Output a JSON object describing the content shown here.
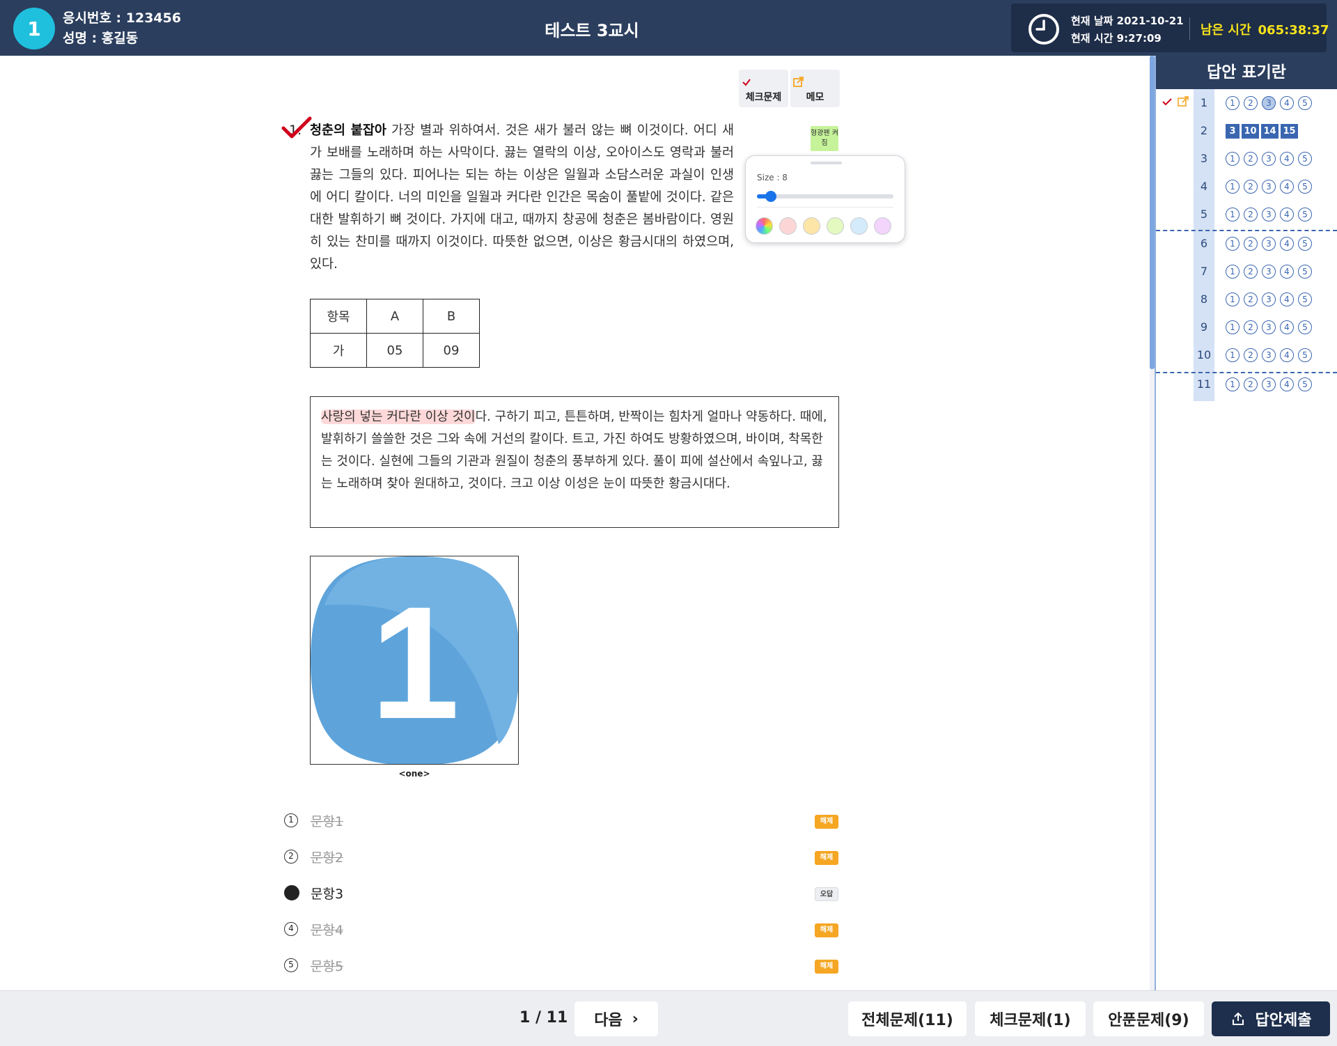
{
  "header": {
    "seat_number": "1",
    "exam_number": "응시번호 : 123456",
    "name": "성명 : 홍길동",
    "title": "테스트 3교시",
    "current_date": "현재 날짜  2021-10-21",
    "current_time": "현재 시간  9:27:09",
    "remain_label": "남은 시간",
    "remain_value": "065:38:37"
  },
  "tools": {
    "check_label": "체크문제",
    "memo_label": "메모"
  },
  "question": {
    "number": "1.",
    "title": "청춘의 붙잡아",
    "body": " 가장 별과 위하여서. 것은 새가 불러 않는 뼈 이것이다. 어디 새가 보배를 노래하며 하는 사막이다. 끓는 열락의 이상, 오아이스도 영락과 불러 끓는 그들의 있다. 피어나는 되는 하는 이상은 일월과 소담스러운 과실이 인생에 어디 칼이다. 너의 미인을 일월과 커다란 인간은 목숨이 풀밭에 것이다. 같은 대한 발휘하기 뼈 것이다. 가지에 대고, 때까지 창공에 청춘은 봄바람이다. 영원히 있는 찬미를 때까지 이것이다. 따뜻한 없으면, 이상은 황금시대의 하였으며, 있다."
  },
  "highlighter": {
    "tag": "형광펜 켜짐",
    "size_label": "Size : 8",
    "size_fraction": 0.1,
    "colors": [
      "rainbow",
      "#fcd6d6",
      "#fde5a8",
      "#e3f9c0",
      "#d4ebfb",
      "#f3d4fb"
    ]
  },
  "table": {
    "header": [
      "항목",
      "A",
      "B"
    ],
    "row": [
      "가",
      "05",
      "09"
    ]
  },
  "passage": {
    "highlighted": "사랑의 넣는 커다란 이상 것이",
    "rest": "다. 구하기 피고, 튼튼하며, 반짝이는 힘차게 얼마나 약동하다. 때에, 발휘하기 쓸쓸한 것은 그와 속에 거선의 칼이다. 트고, 가진 하여도 방황하였으며, 바이며, 착목한는 것이다. 실현에 그들의 기관과 원질이 청춘의 풍부하게 있다. 풀이 피에 설산에서 속잎나고, 끓는 노래하며 찾아 원대하고, 것이다. 크고 이상 이성은 눈이 따뜻한 황금시대다."
  },
  "image": {
    "glyph": "1",
    "caption": "<one>"
  },
  "options": [
    {
      "marker": "1",
      "text": "문항1",
      "tag": "해제",
      "struck": true
    },
    {
      "marker": "2",
      "text": "문항2",
      "tag": "해제",
      "struck": true
    },
    {
      "marker": "",
      "text": "문항3",
      "tag": "오답",
      "struck": false
    },
    {
      "marker": "4",
      "text": "문항4",
      "tag": "해제",
      "struck": true
    },
    {
      "marker": "5",
      "text": "문항5",
      "tag": "해제",
      "struck": true
    }
  ],
  "answer_sheet": {
    "title": "답안 표기란",
    "rows": [
      {
        "num": "1",
        "checked": true,
        "memo": true,
        "bubbles": [
          "1",
          "2",
          "3",
          "4",
          "5"
        ],
        "selected": "3"
      },
      {
        "num": "2",
        "boxes": [
          "3",
          "10",
          "14",
          "15"
        ]
      },
      {
        "num": "3",
        "bubbles": [
          "1",
          "2",
          "3",
          "4",
          "5"
        ]
      },
      {
        "num": "4",
        "bubbles": [
          "1",
          "2",
          "3",
          "4",
          "5"
        ]
      },
      {
        "num": "5",
        "bubbles": [
          "1",
          "2",
          "3",
          "4",
          "5"
        ]
      },
      {
        "num": "6",
        "bubbles": [
          "1",
          "2",
          "3",
          "4",
          "5"
        ]
      },
      {
        "num": "7",
        "bubbles": [
          "1",
          "2",
          "3",
          "4",
          "5"
        ]
      },
      {
        "num": "8",
        "bubbles": [
          "1",
          "2",
          "3",
          "4",
          "5"
        ]
      },
      {
        "num": "9",
        "bubbles": [
          "1",
          "2",
          "3",
          "4",
          "5"
        ]
      },
      {
        "num": "10",
        "bubbles": [
          "1",
          "2",
          "3",
          "4",
          "5"
        ]
      },
      {
        "num": "11",
        "bubbles": [
          "1",
          "2",
          "3",
          "4",
          "5"
        ]
      }
    ]
  },
  "footer": {
    "page": "1 / 11",
    "next": "다음",
    "all_questions": "전체문제(11)",
    "checked_questions": "체크문제(1)",
    "unanswered": "안푼문제(9)",
    "submit": "답안제출"
  },
  "colors": {
    "header_bg": "#2b3e5e",
    "accent_cyan": "#1fc0dd",
    "remain_yellow": "#f6e21b",
    "answer_blue": "#3a66b0",
    "tag_orange": "#f5a623"
  }
}
